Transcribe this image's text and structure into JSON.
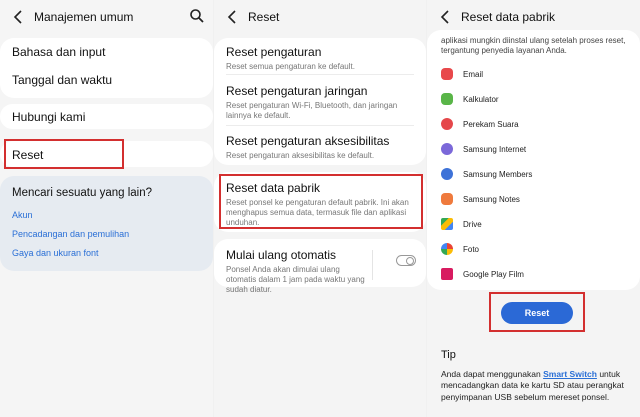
{
  "pane1": {
    "title": "Manajemen umum",
    "items": [
      "Bahasa dan input",
      "Tanggal dan waktu",
      "Hubungi kami",
      "Reset"
    ],
    "help": {
      "title": "Mencari sesuatu yang lain?",
      "links": [
        "Akun",
        "Pencadangan dan pemulihan",
        "Gaya dan ukuran font"
      ]
    }
  },
  "pane2": {
    "title": "Reset",
    "items": [
      {
        "title": "Reset pengaturan",
        "desc": "Reset semua pengaturan ke default."
      },
      {
        "title": "Reset pengaturan jaringan",
        "desc": "Reset pengaturan Wi-Fi, Bluetooth, dan jaringan lainnya ke default."
      },
      {
        "title": "Reset pengaturan aksesibilitas",
        "desc": "Reset pengaturan aksesibilitas ke default."
      },
      {
        "title": "Reset data pabrik",
        "desc": "Reset ponsel ke pengaturan default pabrik. Ini akan menghapus semua data, termasuk file dan aplikasi unduhan."
      },
      {
        "title": "Mulai ulang otomatis",
        "desc": "Ponsel Anda akan dimulai ulang otomatis dalam 1 jam pada waktu yang sudah diatur."
      }
    ]
  },
  "pane3": {
    "title": "Reset data pabrik",
    "intro": "aplikasi mungkin diinstal ulang setelah proses reset, tergantung penyedia layanan Anda.",
    "apps": [
      "Email",
      "Kalkulator",
      "Perekam Suara",
      "Samsung Internet",
      "Samsung Members",
      "Samsung Notes",
      "Drive",
      "Foto",
      "Google Play Film"
    ],
    "reset_button": "Reset",
    "tip_title": "Tip",
    "tip_pre": "Anda dapat menggunakan ",
    "tip_link": "Smart Switch",
    "tip_post": " untuk mencadangkan data ke kartu SD atau perangkat penyimpanan USB sebelum mereset ponsel."
  },
  "colors": {
    "link": "#2a6fd6",
    "highlight": "#d32f2f",
    "button": "#2b69d6"
  }
}
